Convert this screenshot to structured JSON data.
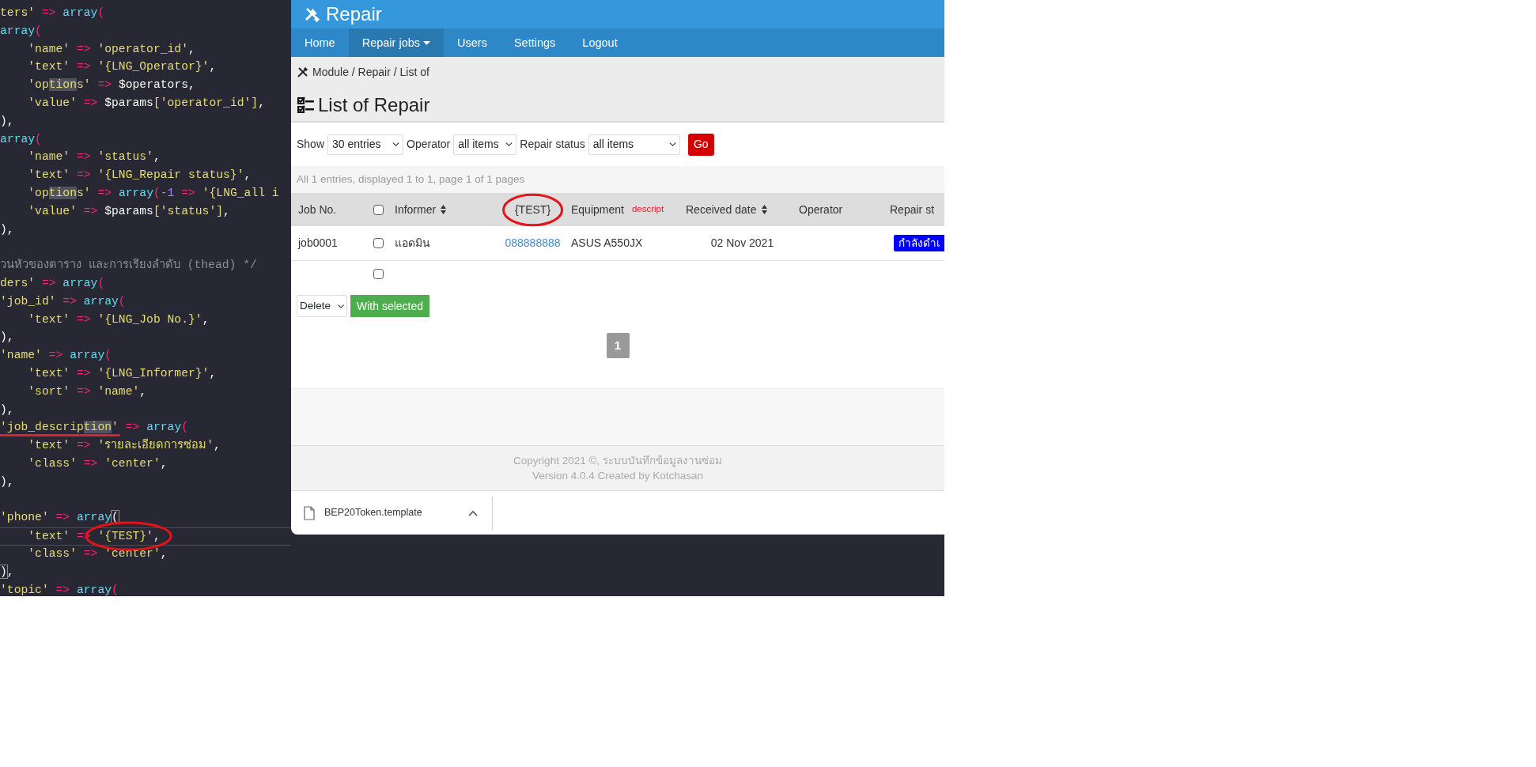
{
  "editor": {
    "lines": [
      {
        "kind": "code",
        "current": false,
        "indented": false,
        "tokens": [
          {
            "kind": "key",
            "text": "ters' "
          },
          {
            "kind": "op",
            "text": "=> "
          },
          {
            "kind": "fn",
            "text": "array"
          },
          {
            "kind": "op",
            "text": "("
          }
        ]
      },
      {
        "kind": "code",
        "current": false,
        "indented": false,
        "tokens": [
          {
            "kind": "fn",
            "text": "array"
          },
          {
            "kind": "op",
            "text": "("
          }
        ]
      },
      {
        "kind": "code",
        "current": false,
        "indented": true,
        "tokens": [
          {
            "kind": "key",
            "text": "'name' "
          },
          {
            "kind": "op",
            "text": "=> "
          },
          {
            "kind": "key",
            "text": "'operator_id'"
          },
          {
            "kind": "plain",
            "text": ","
          }
        ]
      },
      {
        "kind": "code",
        "current": false,
        "indented": true,
        "tokens": [
          {
            "kind": "key",
            "text": "'text' "
          },
          {
            "kind": "op",
            "text": "=> "
          },
          {
            "kind": "key",
            "text": "'{LNG_Operator}'"
          },
          {
            "kind": "plain",
            "text": ","
          }
        ]
      },
      {
        "kind": "code",
        "current": false,
        "indented": true,
        "tokens": [
          {
            "kind": "key",
            "text": "'op"
          },
          {
            "kind": "match",
            "text": "tion"
          },
          {
            "kind": "key",
            "text": "s' "
          },
          {
            "kind": "op",
            "text": "=> "
          },
          {
            "kind": "plain",
            "text": "$operators,"
          }
        ]
      },
      {
        "kind": "code",
        "current": false,
        "indented": true,
        "tokens": [
          {
            "kind": "key",
            "text": "'value' "
          },
          {
            "kind": "op",
            "text": "=> "
          },
          {
            "kind": "plain",
            "text": "$params"
          },
          {
            "kind": "key",
            "text": "['operator_id']"
          },
          {
            "kind": "plain",
            "text": ","
          }
        ]
      },
      {
        "kind": "code",
        "current": false,
        "indented": false,
        "tokens": [
          {
            "kind": "plain",
            "text": "),"
          }
        ]
      },
      {
        "kind": "code",
        "current": false,
        "indented": false,
        "tokens": [
          {
            "kind": "fn",
            "text": "array"
          },
          {
            "kind": "op",
            "text": "("
          }
        ]
      },
      {
        "kind": "code",
        "current": false,
        "indented": true,
        "tokens": [
          {
            "kind": "key",
            "text": "'name' "
          },
          {
            "kind": "op",
            "text": "=> "
          },
          {
            "kind": "key",
            "text": "'status'"
          },
          {
            "kind": "plain",
            "text": ","
          }
        ]
      },
      {
        "kind": "code",
        "current": false,
        "indented": true,
        "tokens": [
          {
            "kind": "key",
            "text": "'text' "
          },
          {
            "kind": "op",
            "text": "=> "
          },
          {
            "kind": "key",
            "text": "'{LNG_Repair status}'"
          },
          {
            "kind": "plain",
            "text": ","
          }
        ]
      },
      {
        "kind": "code",
        "current": false,
        "indented": true,
        "tokens": [
          {
            "kind": "key",
            "text": "'op"
          },
          {
            "kind": "match",
            "text": "tion"
          },
          {
            "kind": "key",
            "text": "s' "
          },
          {
            "kind": "op",
            "text": "=> "
          },
          {
            "kind": "fn",
            "text": "array"
          },
          {
            "kind": "op",
            "text": "("
          },
          {
            "kind": "num",
            "text": "-1 "
          },
          {
            "kind": "op",
            "text": "=> "
          },
          {
            "kind": "key",
            "text": "'{LNG_all i"
          }
        ]
      },
      {
        "kind": "code",
        "current": false,
        "indented": true,
        "tokens": [
          {
            "kind": "key",
            "text": "'value' "
          },
          {
            "kind": "op",
            "text": "=> "
          },
          {
            "kind": "plain",
            "text": "$params"
          },
          {
            "kind": "key",
            "text": "['status']"
          },
          {
            "kind": "plain",
            "text": ","
          }
        ]
      },
      {
        "kind": "code",
        "current": false,
        "indented": false,
        "tokens": [
          {
            "kind": "plain",
            "text": "),"
          }
        ]
      },
      {
        "kind": "blank",
        "current": false
      },
      {
        "kind": "code",
        "current": false,
        "indented": false,
        "tokens": [
          {
            "kind": "comment",
            "text": "วนหัวของตาราง และการเรียงลำดับ (thead) */"
          }
        ]
      },
      {
        "kind": "code",
        "current": false,
        "indented": false,
        "tokens": [
          {
            "kind": "key",
            "text": "ders' "
          },
          {
            "kind": "op",
            "text": "=> "
          },
          {
            "kind": "fn",
            "text": "array"
          },
          {
            "kind": "op",
            "text": "("
          }
        ]
      },
      {
        "kind": "code",
        "current": false,
        "indented": false,
        "tokens": [
          {
            "kind": "key",
            "text": "'job_id' "
          },
          {
            "kind": "op",
            "text": "=> "
          },
          {
            "kind": "fn",
            "text": "array"
          },
          {
            "kind": "op",
            "text": "("
          }
        ]
      },
      {
        "kind": "code",
        "current": false,
        "indented": true,
        "tokens": [
          {
            "kind": "key",
            "text": "'text' "
          },
          {
            "kind": "op",
            "text": "=> "
          },
          {
            "kind": "key",
            "text": "'{LNG_Job No.}'"
          },
          {
            "kind": "plain",
            "text": ","
          }
        ]
      },
      {
        "kind": "code",
        "current": false,
        "indented": false,
        "tokens": [
          {
            "kind": "plain",
            "text": "),"
          }
        ]
      },
      {
        "kind": "code",
        "current": false,
        "indented": false,
        "tokens": [
          {
            "kind": "key",
            "text": "'name' "
          },
          {
            "kind": "op",
            "text": "=> "
          },
          {
            "kind": "fn",
            "text": "array"
          },
          {
            "kind": "op",
            "text": "("
          }
        ]
      },
      {
        "kind": "code",
        "current": false,
        "indented": true,
        "tokens": [
          {
            "kind": "key",
            "text": "'text' "
          },
          {
            "kind": "op",
            "text": "=> "
          },
          {
            "kind": "key",
            "text": "'{LNG_Informer}'"
          },
          {
            "kind": "plain",
            "text": ","
          }
        ]
      },
      {
        "kind": "code",
        "current": false,
        "indented": true,
        "tokens": [
          {
            "kind": "key",
            "text": "'sort' "
          },
          {
            "kind": "op",
            "text": "=> "
          },
          {
            "kind": "key",
            "text": "'name'"
          },
          {
            "kind": "plain",
            "text": ","
          }
        ]
      },
      {
        "kind": "code",
        "current": false,
        "indented": false,
        "tokens": [
          {
            "kind": "plain",
            "text": "),"
          }
        ]
      },
      {
        "kind": "code",
        "current": false,
        "indented": false,
        "tokens": [
          {
            "kind": "key",
            "text": "'job_descrip",
            "underlined": true
          },
          {
            "kind": "match",
            "text": "tion",
            "underlined": true
          },
          {
            "kind": "key",
            "text": "'",
            "underlined": true
          },
          {
            "kind": "op",
            "text": " => "
          },
          {
            "kind": "fn",
            "text": "array"
          },
          {
            "kind": "op",
            "text": "("
          }
        ]
      },
      {
        "kind": "code",
        "current": false,
        "indented": true,
        "tokens": [
          {
            "kind": "key",
            "text": "'text' "
          },
          {
            "kind": "op",
            "text": "=> "
          },
          {
            "kind": "key",
            "text": "'รายละเอียดการซ่อม'"
          },
          {
            "kind": "plain",
            "text": ","
          }
        ]
      },
      {
        "kind": "code",
        "current": false,
        "indented": true,
        "tokens": [
          {
            "kind": "key",
            "text": "'class' "
          },
          {
            "kind": "op",
            "text": "=> "
          },
          {
            "kind": "key",
            "text": "'center'"
          },
          {
            "kind": "plain",
            "text": ","
          }
        ]
      },
      {
        "kind": "code",
        "current": false,
        "indented": false,
        "tokens": [
          {
            "kind": "plain",
            "text": "),"
          }
        ]
      },
      {
        "kind": "blank",
        "current": false
      },
      {
        "kind": "code",
        "current": false,
        "indented": false,
        "tokens": [
          {
            "kind": "key",
            "text": "'phone' "
          },
          {
            "kind": "op",
            "text": "=> "
          },
          {
            "kind": "fn",
            "text": "array"
          },
          {
            "kind": "bracket",
            "text": "("
          }
        ]
      },
      {
        "kind": "code",
        "current": true,
        "indented": true,
        "tokens": [
          {
            "kind": "key",
            "text": "'text' "
          },
          {
            "kind": "op",
            "text": "=> "
          },
          {
            "kind": "key",
            "text": "'{TEST}'",
            "circled": true
          },
          {
            "kind": "plain",
            "text": ",",
            "circled": true
          }
        ]
      },
      {
        "kind": "code",
        "current": false,
        "indented": true,
        "tokens": [
          {
            "kind": "key",
            "text": "'class' "
          },
          {
            "kind": "op",
            "text": "=> "
          },
          {
            "kind": "key",
            "text": "'center'"
          },
          {
            "kind": "plain",
            "text": ","
          }
        ]
      },
      {
        "kind": "code",
        "current": false,
        "indented": false,
        "tokens": [
          {
            "kind": "bracket",
            "text": ")"
          },
          {
            "kind": "plain",
            "text": ","
          }
        ]
      },
      {
        "kind": "code",
        "current": false,
        "indented": false,
        "tokens": [
          {
            "kind": "key",
            "text": "'topic' "
          },
          {
            "kind": "op",
            "text": "=> "
          },
          {
            "kind": "fn",
            "text": "array"
          },
          {
            "kind": "op",
            "text": "("
          }
        ]
      }
    ]
  },
  "browser": {
    "app_title": "Repair",
    "nav": [
      {
        "label": "Home",
        "selected": false,
        "dropdown": false
      },
      {
        "label": "Repair jobs",
        "selected": true,
        "dropdown": true
      },
      {
        "label": "Users",
        "selected": false,
        "dropdown": false
      },
      {
        "label": "Settings",
        "selected": false,
        "dropdown": false
      },
      {
        "label": "Logout",
        "selected": false,
        "dropdown": false
      }
    ],
    "breadcrumb": "Module / Repair / List of",
    "page_title": "List of Repair",
    "filters": [
      {
        "label": "Show",
        "value": "30 entries"
      },
      {
        "label": "Operator",
        "value": "all items"
      },
      {
        "label": "Repair status",
        "value": "all items"
      }
    ],
    "go_button": "Go",
    "summary": "All 1 entries, displayed 1 to 1, page 1 of 1 pages",
    "table": {
      "columns": [
        {
          "kind": "text",
          "label": "Job No.",
          "sortable": false
        },
        {
          "kind": "checkbox",
          "checked": false
        },
        {
          "kind": "text",
          "label": "Informer",
          "sortable": true
        },
        {
          "kind": "text",
          "label": "{TEST}",
          "sortable": false,
          "circled": true
        },
        {
          "kind": "text",
          "label": "Equipment",
          "note": "descript",
          "sortable": false
        },
        {
          "kind": "text",
          "label": "Received date",
          "sortable": true
        },
        {
          "kind": "text",
          "label": "Operator",
          "sortable": false
        },
        {
          "kind": "text",
          "label": "Repair st",
          "sortable": false
        }
      ],
      "rows": [
        {
          "job_no": "job0001",
          "checked": false,
          "informer": "แอดมิน",
          "phone": "088888888",
          "equipment": "ASUS A550JX",
          "received_date": "02 Nov 2021",
          "status": "กำลังดำเ"
        },
        {
          "checked": false
        }
      ]
    },
    "bulk_action": {
      "value": "Delete",
      "button": "With selected"
    },
    "pagination": [
      {
        "label": "1",
        "selected": true
      }
    ],
    "footer": [
      "Copyright 2021 ©, ระบบบันทึกข้อมูลงานซ่อม",
      "Version 4.0.4 Created by Kotchasan"
    ],
    "download": {
      "file": "BEP20Token.template"
    }
  }
}
